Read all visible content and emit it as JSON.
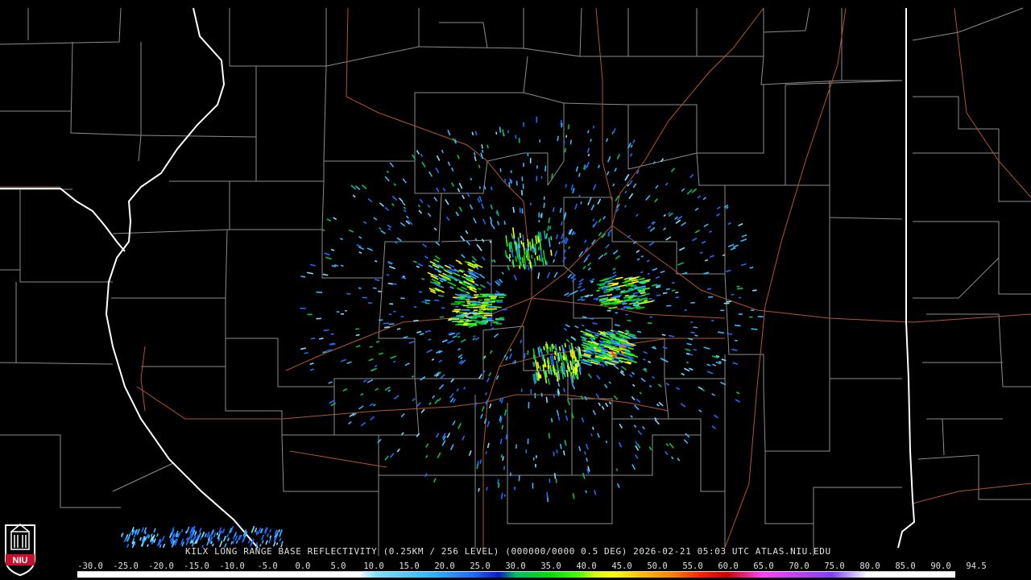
{
  "caption": "KILX LONG RANGE BASE REFLECTIVITY (0.25KM / 256 LEVEL) (000000/0000 0.5 DEG) 2026-02-21 05:03 UTC  ATLAS.NIU.EDU",
  "scale_labels": [
    "-30.0",
    "-25.0",
    "-20.0",
    "-15.0",
    "-10.0",
    "-5.0",
    "0.0",
    "5.0",
    "10.0",
    "15.0",
    "20.0",
    "25.0",
    "30.0",
    "35.0",
    "40.0",
    "45.0",
    "50.0",
    "55.0",
    "60.0",
    "65.0",
    "70.0",
    "75.0",
    "80.0",
    "85.0",
    "90.0",
    "94.5"
  ],
  "logo_text": "NIU",
  "colors": {
    "background": "#000000",
    "county_lines": "#9a9a9a",
    "state_lines": "#ffffff",
    "highways": "#b0562a"
  }
}
